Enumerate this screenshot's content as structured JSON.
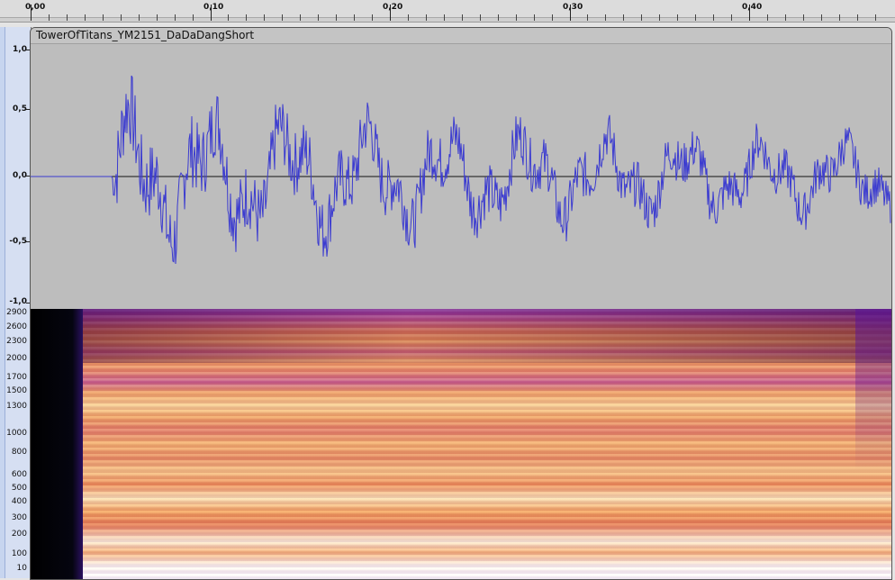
{
  "timeline": {
    "labels": [
      "0,00",
      "0,10",
      "0,20",
      "0,30",
      "0,40"
    ]
  },
  "track": {
    "name": "TowerOfTitans_YM2151_DaDaDangShort"
  },
  "amplitude_scale": {
    "labels": [
      "1,0",
      "0,5",
      "0,0",
      "-0,5",
      "-1,0"
    ]
  },
  "frequency_scale": {
    "labels": [
      "2900",
      "2600",
      "2300",
      "2000",
      "1700",
      "1500",
      "1300",
      "1000",
      "800",
      "600",
      "500",
      "400",
      "300",
      "200",
      "100",
      "10"
    ]
  },
  "colors": {
    "waveform": "#3b3bd0",
    "waveform_bg": "#bdbdbd",
    "ruler_bg": "#d6dff2"
  }
}
